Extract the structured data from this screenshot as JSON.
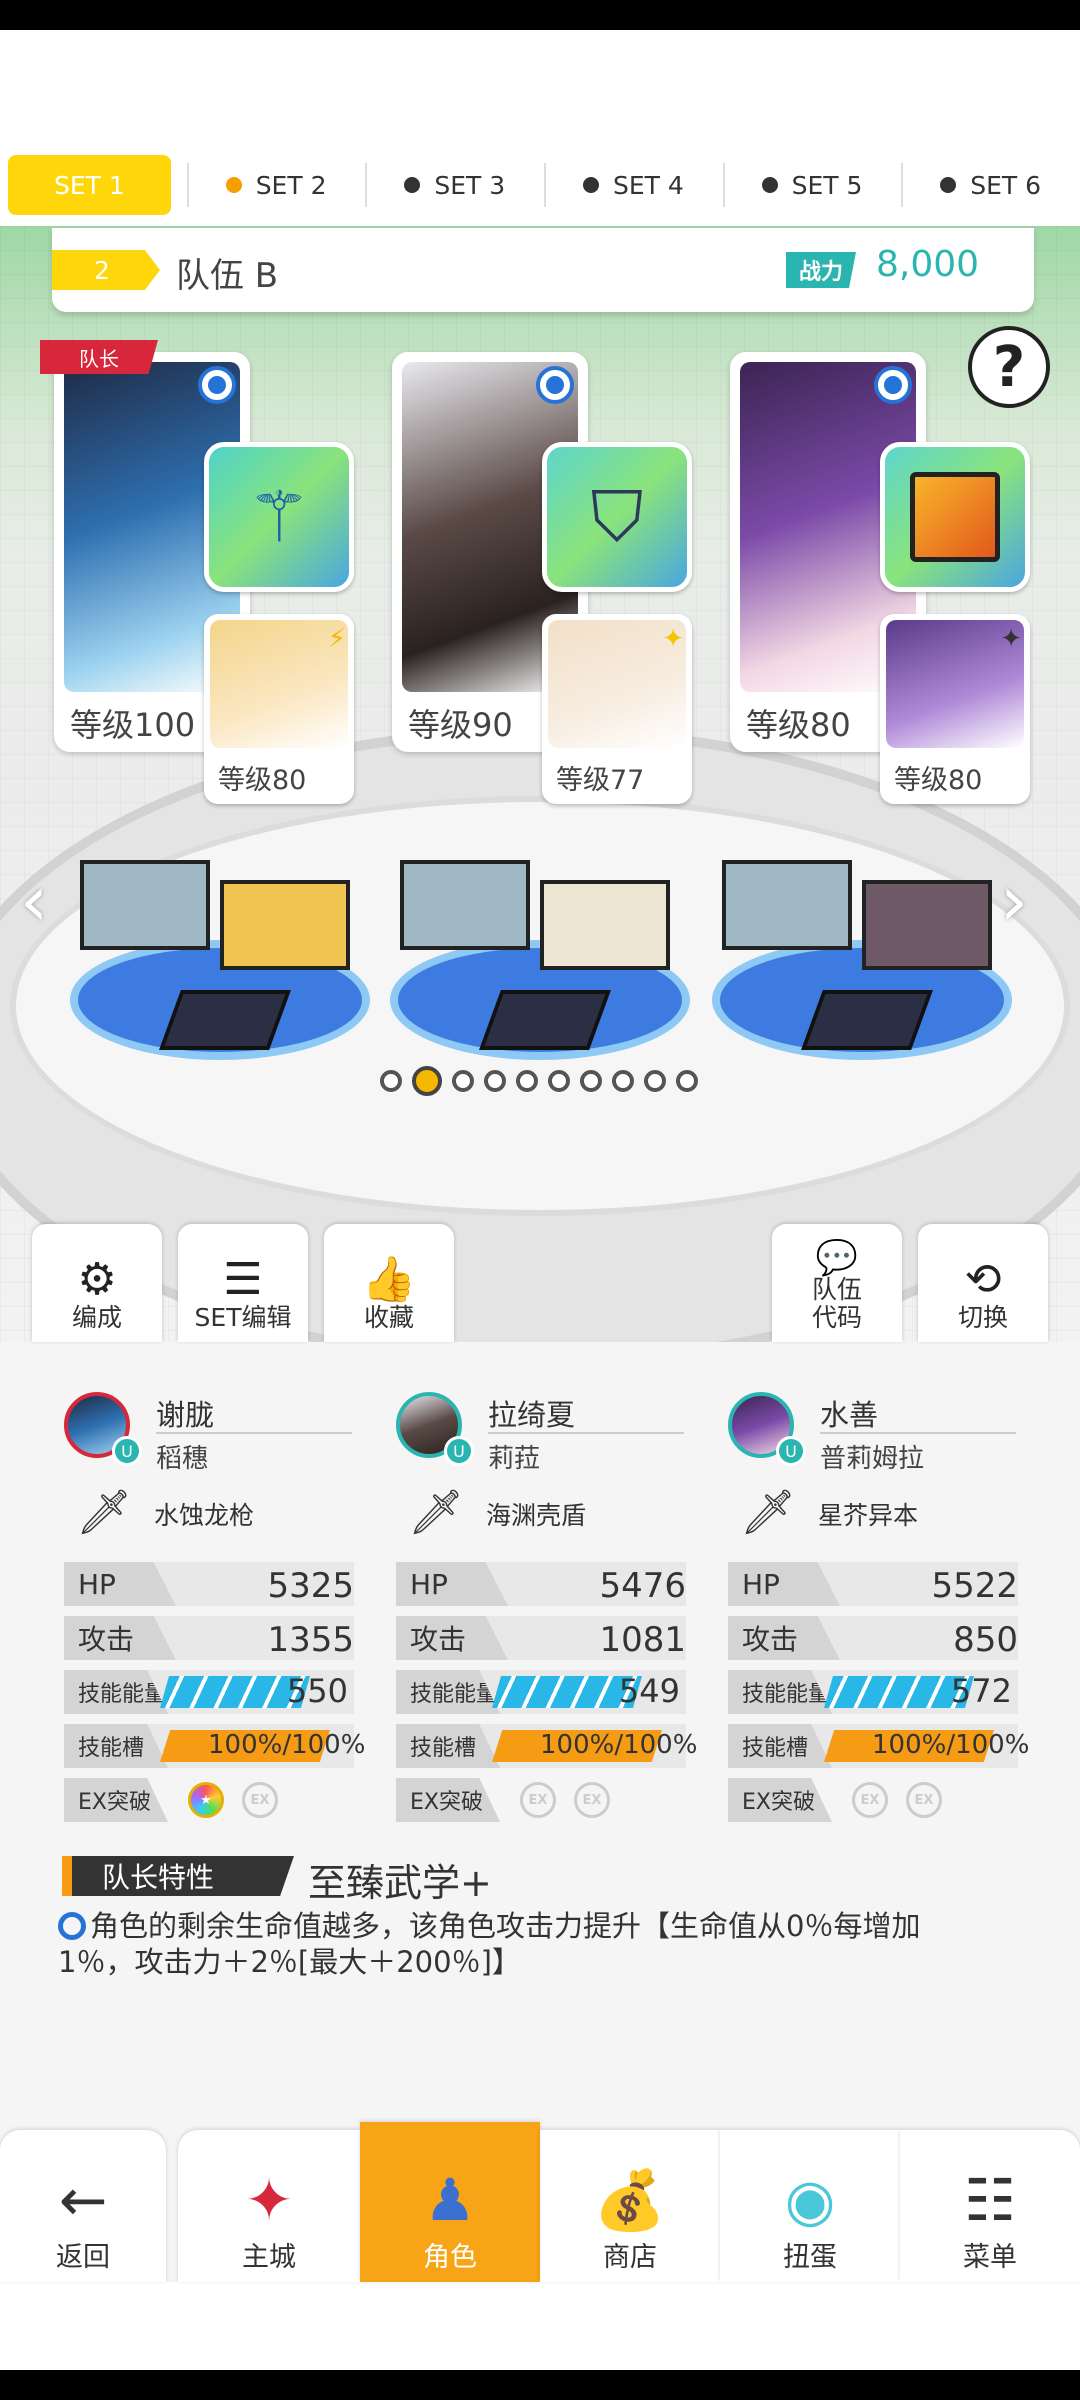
{
  "set_tabs": [
    {
      "label": "SET 1",
      "active": true
    },
    {
      "label": "SET 2",
      "dot": "orange"
    },
    {
      "label": "SET 3",
      "dot": "dark"
    },
    {
      "label": "SET 4",
      "dot": "dark"
    },
    {
      "label": "SET 5",
      "dot": "dark"
    },
    {
      "label": "SET 6",
      "dot": "dark"
    }
  ],
  "team": {
    "number": "2",
    "name": "队伍 B",
    "power_label": "战力",
    "power_value": "8,000"
  },
  "help_icon": "?",
  "leader_tag": "队长",
  "cards": [
    {
      "level": "等级100",
      "sub_level": "等级80",
      "weapon_icon": "trident-icon"
    },
    {
      "level": "等级90",
      "sub_level": "等级77",
      "weapon_icon": "shield-icon"
    },
    {
      "level": "等级80",
      "sub_level": "等级80",
      "weapon_icon": "book-icon"
    }
  ],
  "nav_arrows": {
    "left": "‹",
    "right": "›"
  },
  "page_count": 10,
  "page_active": 1,
  "actions": {
    "formation": "编成",
    "set_edit": "SET编辑",
    "favorite": "收藏",
    "team_code_1": "队伍",
    "team_code_2": "代码",
    "switch": "切换"
  },
  "heroes": [
    {
      "name": "谢胧",
      "sub": "稻穗",
      "weapon": "水蚀龙枪",
      "hp": "5325",
      "atk": "1355",
      "energy": "550",
      "slot": "100%/100%"
    },
    {
      "name": "拉绮夏",
      "sub": "莉菈",
      "weapon": "海渊壳盾",
      "hp": "5476",
      "atk": "1081",
      "energy": "549",
      "slot": "100%/100%"
    },
    {
      "name": "水善",
      "sub": "普莉姆拉",
      "weapon": "星芥异本",
      "hp": "5522",
      "atk": "850",
      "energy": "572",
      "slot": "100%/100%"
    }
  ],
  "stat_labels": {
    "hp": "HP",
    "atk": "攻击",
    "energy": "技能能量",
    "slot": "技能槽",
    "ex": "EX突破",
    "ex_icon": "EX"
  },
  "leader_skill": {
    "title": "队长特性",
    "name": "至臻武学+",
    "desc": "角色的剩余生命值越多，该角色攻击力提升【生命值从0％每增加1％，攻击力＋2％[最大＋200％]】"
  },
  "bottom_nav": {
    "back": "返回",
    "castle": "主城",
    "character": "角色",
    "shop": "商店",
    "gacha": "扭蛋",
    "menu": "菜单"
  },
  "colors": {
    "accent_yellow": "#ffd60a",
    "teal": "#2bb5b0",
    "orange": "#f7a416",
    "leader_red": "#d8263a",
    "energy_blue": "#29b7e8"
  }
}
